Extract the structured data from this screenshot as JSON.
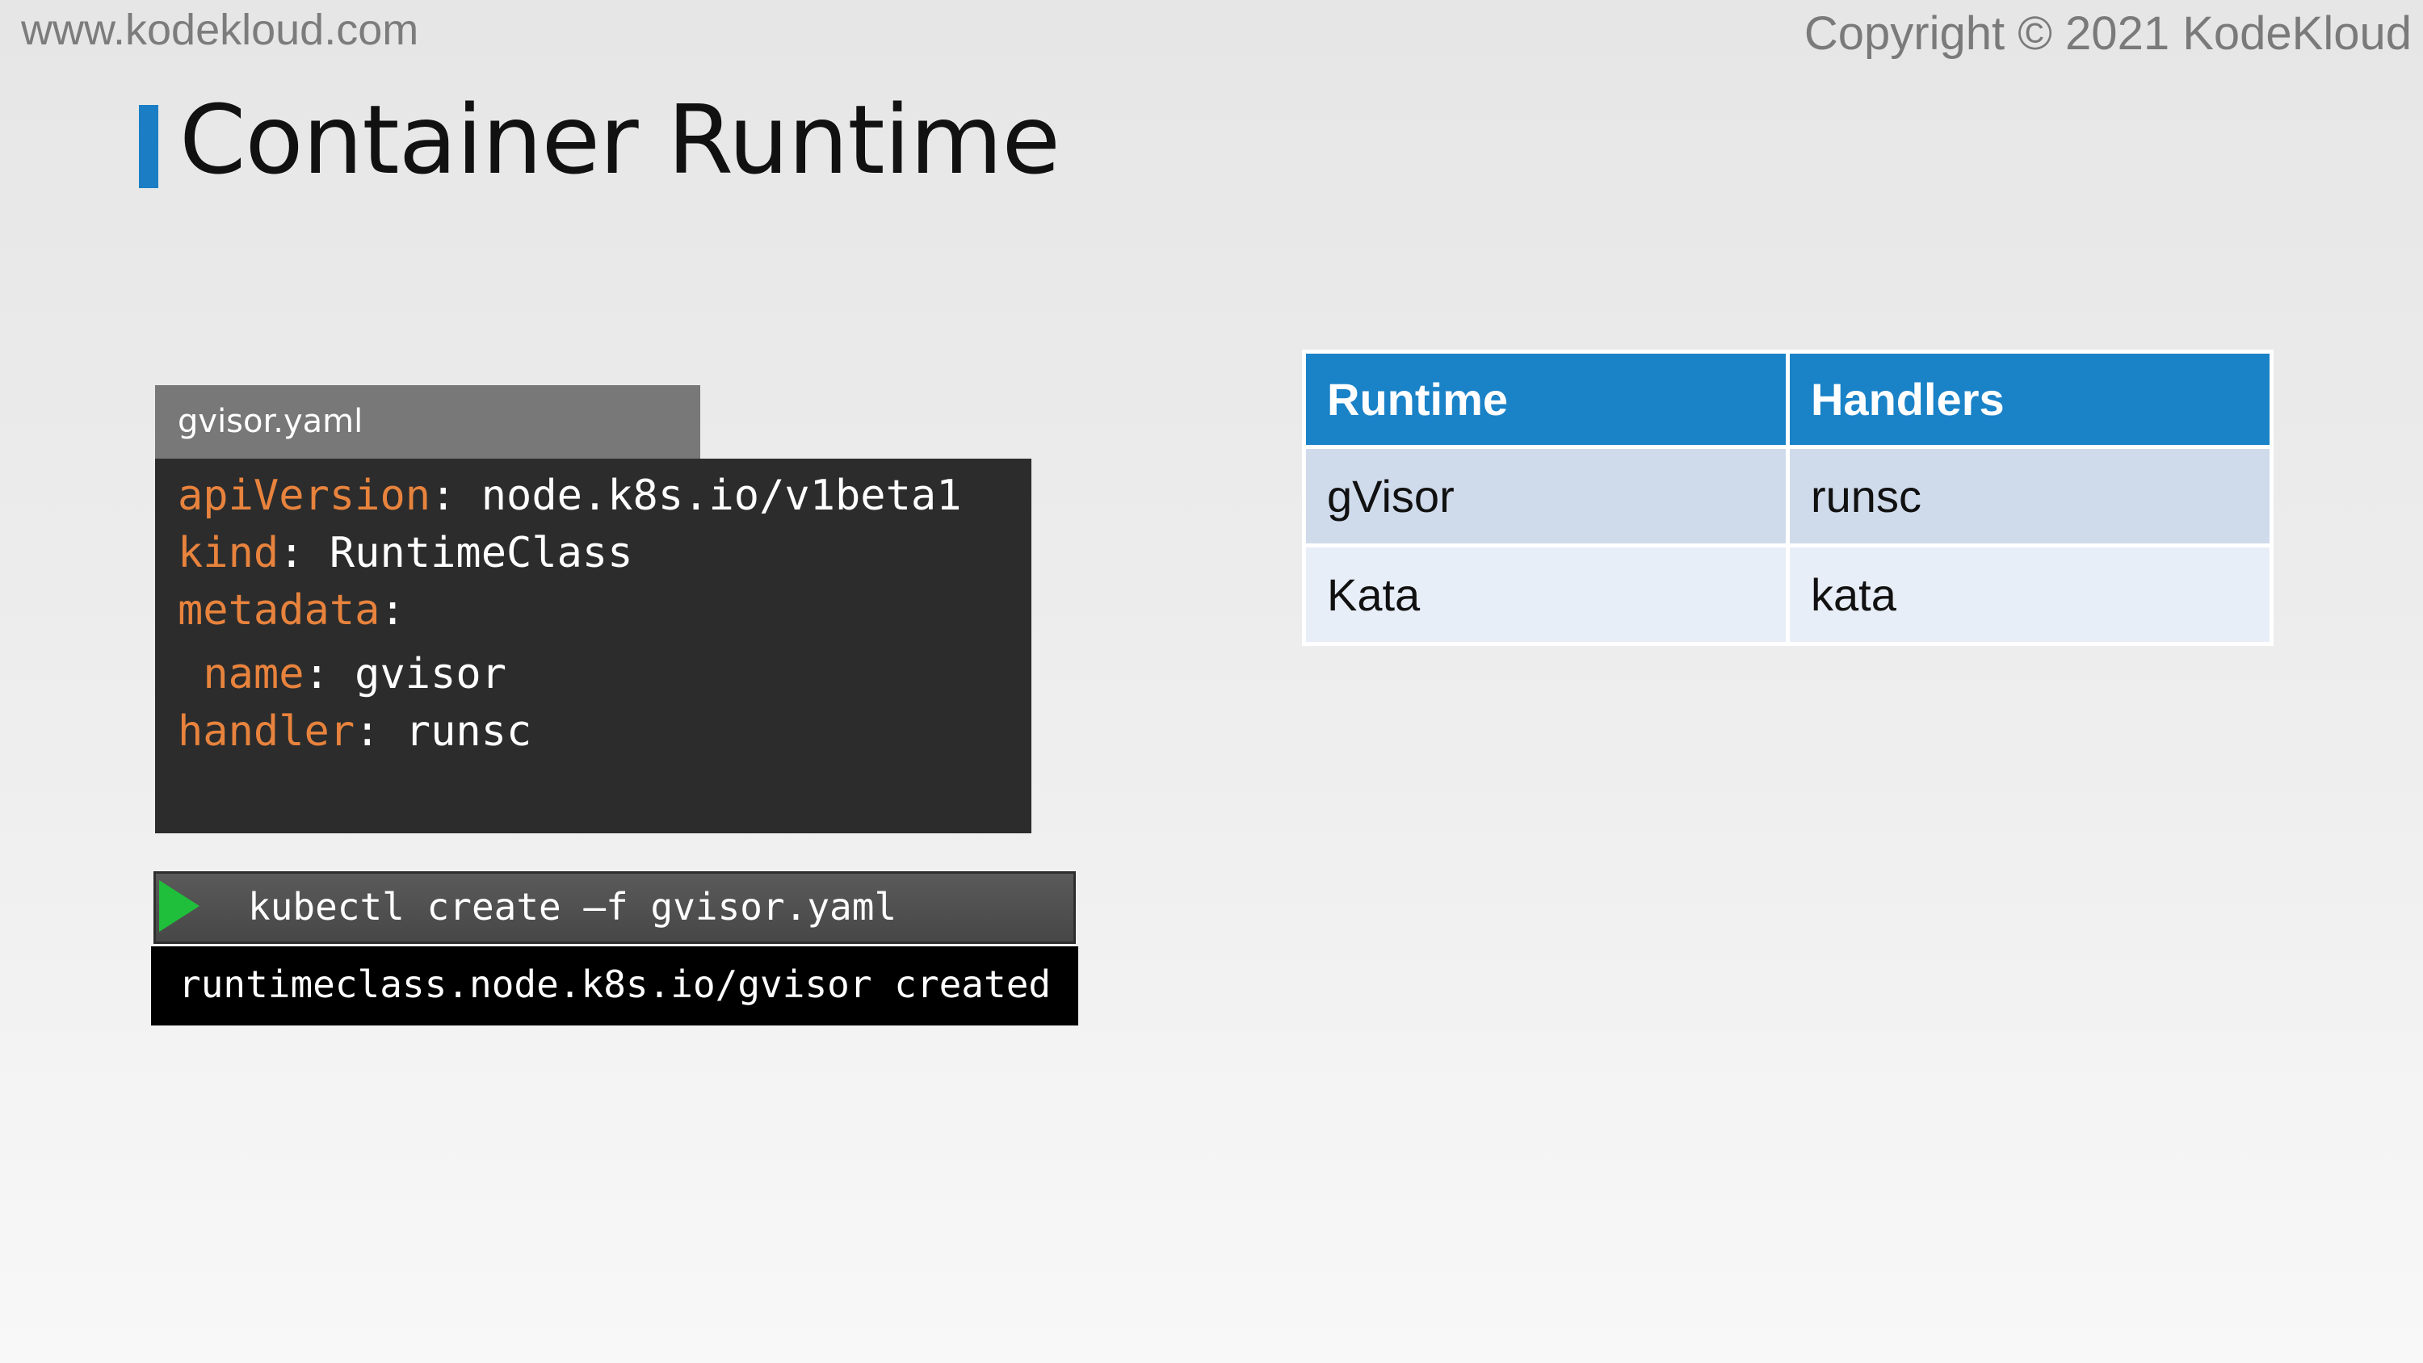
{
  "header": {
    "site_url": "www.kodekloud.com",
    "copyright": "Copyright © 2021 KodeKloud"
  },
  "slide": {
    "title": "Container Runtime"
  },
  "yaml_file": {
    "filename": "gvisor.yaml",
    "lines": [
      {
        "key": "apiVersion",
        "sep": ": ",
        "value": "node.k8s.io/v1beta1",
        "indent": ""
      },
      {
        "key": "kind",
        "sep": ": ",
        "value": "RuntimeClass",
        "indent": ""
      },
      {
        "key": "metadata",
        "sep": ":",
        "value": "",
        "indent": ""
      },
      {
        "key": "name",
        "sep": ": ",
        "value": "gvisor",
        "indent": " "
      },
      {
        "key": "handler",
        "sep": ": ",
        "value": "runsc",
        "indent": ""
      }
    ]
  },
  "terminal": {
    "command": "kubectl create –f gvisor.yaml",
    "output": "runtimeclass.node.k8s.io/gvisor created"
  },
  "runtime_table": {
    "headers": [
      "Runtime",
      "Handlers"
    ],
    "rows": [
      [
        "gVisor",
        "runsc"
      ],
      [
        "Kata",
        "kata"
      ]
    ]
  },
  "colors": {
    "accent_blue": "#1b7ec4",
    "yaml_key_orange": "#e8833d",
    "run_icon_green": "#1fbf3b"
  },
  "icons": {
    "run": "play-triangle-icon"
  }
}
